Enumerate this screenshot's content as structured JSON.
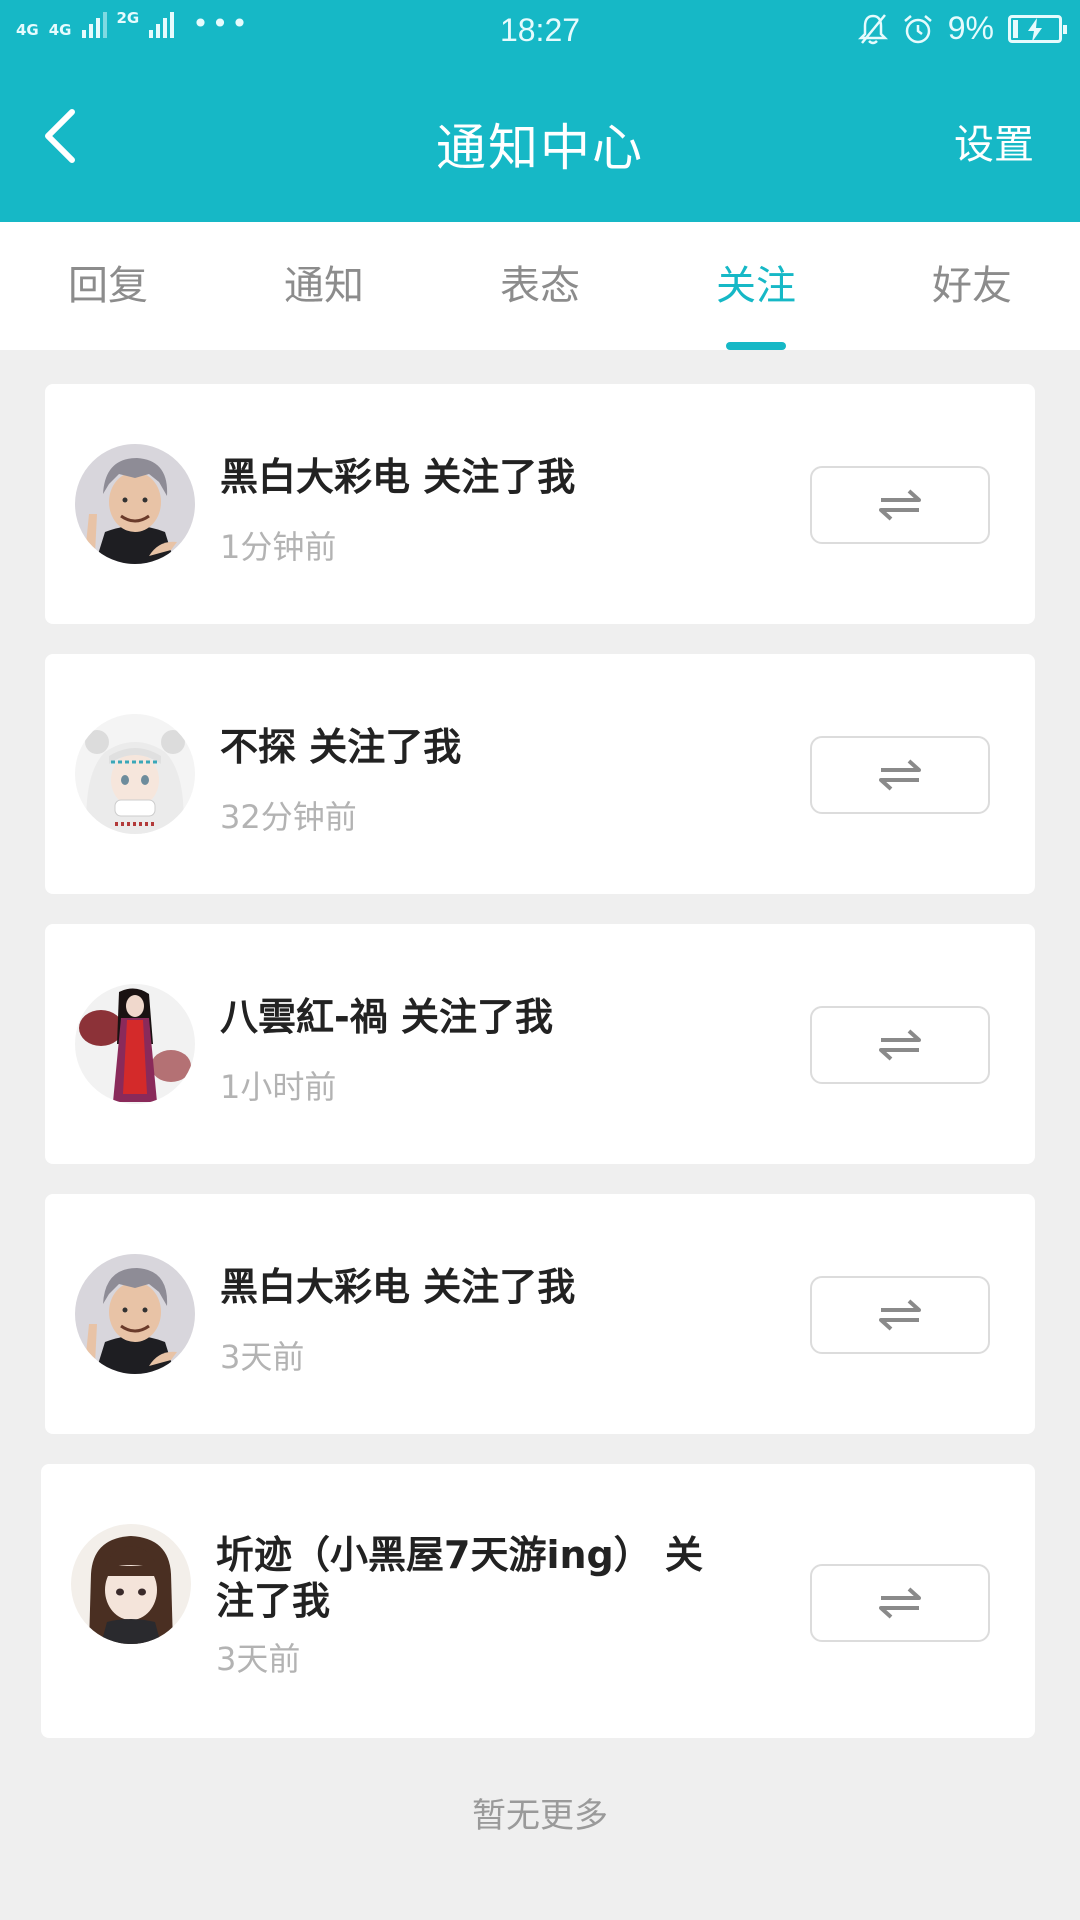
{
  "status_bar": {
    "network_labels": [
      "4G",
      "4G",
      "2G"
    ],
    "time": "18:27",
    "battery": "9%",
    "icons": [
      "bell-off-icon",
      "alarm-icon",
      "charging-battery-icon"
    ]
  },
  "nav": {
    "back_icon": "chevron-left-icon",
    "title": "通知中心",
    "settings": "设置"
  },
  "tabs": [
    {
      "label": "回复",
      "active": false
    },
    {
      "label": "通知",
      "active": false
    },
    {
      "label": "表态",
      "active": false
    },
    {
      "label": "关注",
      "active": true
    },
    {
      "label": "好友",
      "active": false
    }
  ],
  "notifications": [
    {
      "title": "黑白大彩电 关注了我",
      "time": "1分钟前",
      "avatar": "gray-haired-man-avatar",
      "button_icon": "swap-arrows-icon"
    },
    {
      "title": "不探 关注了我",
      "time": "32分钟前",
      "avatar": "white-haired-girl-avatar",
      "button_icon": "swap-arrows-icon"
    },
    {
      "title": "八雲紅-禍 关注了我",
      "time": "1小时前",
      "avatar": "red-dress-girl-avatar",
      "button_icon": "swap-arrows-icon"
    },
    {
      "title": "黑白大彩电 关注了我",
      "time": "3天前",
      "avatar": "gray-haired-man-avatar",
      "button_icon": "swap-arrows-icon"
    },
    {
      "title_line1": "圻迹（小黑屋7天游ing） 关",
      "title_line2": "注了我",
      "time": "3天前",
      "avatar": "brown-haired-girl-avatar",
      "button_icon": "swap-arrows-icon"
    }
  ],
  "footer": "暂无更多",
  "colors": {
    "accent": "#16b8c6",
    "background": "#efefef"
  }
}
